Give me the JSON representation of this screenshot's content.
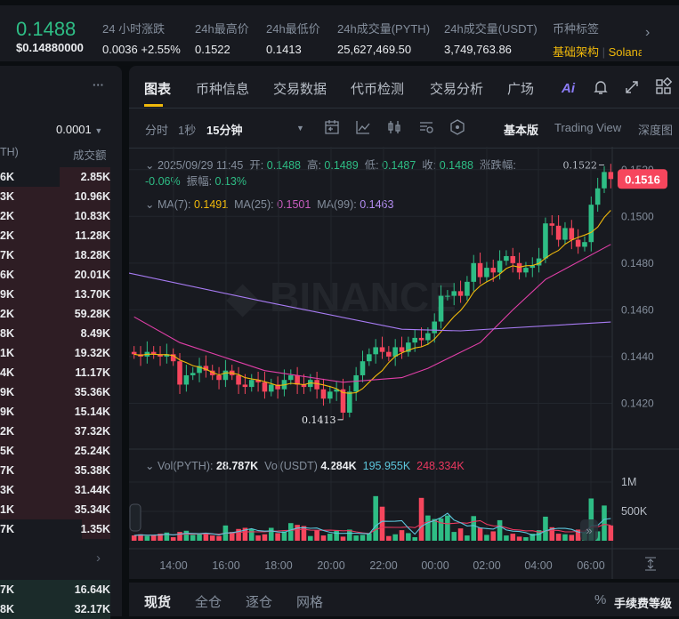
{
  "header": {
    "price": "0.1488",
    "price_usd": "$0.14880000",
    "stats": [
      {
        "label": "24 小时涨跌",
        "value": "0.0036 +2.55%"
      },
      {
        "label": "24h最高价",
        "value": "0.1522"
      },
      {
        "label": "24h最低价",
        "value": "0.1413"
      },
      {
        "label": "24h成交量(PYTH)",
        "value": "25,627,469.50"
      },
      {
        "label": "24h成交量(USDT)",
        "value": "3,749,763.86"
      }
    ],
    "tags_label": "币种标签",
    "tag1": "基础架构",
    "tag2": "Solana"
  },
  "orderbook": {
    "more": "···",
    "precision": "0.0001",
    "col_left": "TH)",
    "col_right": "成交额",
    "asks": [
      [
        "6K",
        "2.85K"
      ],
      [
        "3K",
        "10.96K"
      ],
      [
        "2K",
        "10.83K"
      ],
      [
        "2K",
        "11.28K"
      ],
      [
        "7K",
        "18.28K"
      ],
      [
        "6K",
        "20.01K"
      ],
      [
        "9K",
        "13.70K"
      ],
      [
        "2K",
        "59.28K"
      ],
      [
        "8K",
        "8.49K"
      ],
      [
        "1K",
        "19.32K"
      ],
      [
        "4K",
        "11.17K"
      ],
      [
        "9K",
        "35.36K"
      ],
      [
        "9K",
        "15.14K"
      ],
      [
        "2K",
        "37.32K"
      ],
      [
        "5K",
        "25.24K"
      ],
      [
        "7K",
        "35.38K"
      ],
      [
        "3K",
        "31.44K"
      ],
      [
        "1K",
        "35.34K"
      ],
      [
        "7K",
        "1.35K"
      ]
    ],
    "bids": [
      [
        "7K",
        "16.64K"
      ],
      [
        "8K",
        "32.17K"
      ]
    ]
  },
  "tabs": [
    "图表",
    "币种信息",
    "交易数据",
    "代币检测",
    "交易分析",
    "广场"
  ],
  "ai_label": "Ai",
  "toolbar": {
    "intervals": [
      "分时",
      "1秒",
      "15分钟"
    ],
    "views": [
      "基本版",
      "Trading View",
      "深度图"
    ]
  },
  "legend": {
    "date": "2025/09/29 11:45",
    "open_l": "开:",
    "open": "0.1488",
    "high_l": "高:",
    "high": "0.1489",
    "low_l": "低:",
    "low": "0.1487",
    "close_l": "收:",
    "close": "0.1488",
    "chg_l": "涨跌幅:",
    "chg": "-0.06%",
    "amp_l": "振幅:",
    "amp": "0.13%",
    "ma7_l": "MA(7):",
    "ma7": "0.1491",
    "ma25_l": "MA(25):",
    "ma25": "0.1501",
    "ma99_l": "MA(99):",
    "ma99": "0.1463",
    "vol_l": "Vol(PYTH):",
    "vol": "28.787K",
    "volu_l": "Vol(USDT)",
    "volu": "4.284K",
    "vma5": "195.955K",
    "vma10": "248.334K"
  },
  "colors": {
    "up": "#2ebd85",
    "down": "#f6465d",
    "ma7": "#f0b90b",
    "ma25": "#e13fa8",
    "ma99": "#a77bf3",
    "vma5": "#5cc6dc",
    "vma10": "#e8385f"
  },
  "chart_data": {
    "type": "candlestick",
    "y_ticks": [
      "0.1520",
      "0.1500",
      "0.1480",
      "0.1460",
      "0.1440",
      "0.1420"
    ],
    "y_range": [
      0.1408,
      0.1526
    ],
    "x_ticks": [
      "14:00",
      "16:00",
      "18:00",
      "20:00",
      "22:00",
      "00:00",
      "02:00",
      "04:00",
      "06:00"
    ],
    "current_price": "0.1516",
    "max_label": "0.1522",
    "min_label": "0.1413",
    "closes": [
      0.1441,
      0.144,
      0.1442,
      0.1441,
      0.144,
      0.1441,
      0.1438,
      0.1428,
      0.1432,
      0.1433,
      0.1436,
      0.1434,
      0.1432,
      0.143,
      0.1434,
      0.1432,
      0.1428,
      0.1427,
      0.143,
      0.1429,
      0.1425,
      0.1428,
      0.1426,
      0.143,
      0.1432,
      0.1428,
      0.1427,
      0.143,
      0.1426,
      0.1422,
      0.1425,
      0.1426,
      0.1416,
      0.1425,
      0.1432,
      0.1438,
      0.1441,
      0.1444,
      0.1442,
      0.144,
      0.1444,
      0.1442,
      0.1446,
      0.1448,
      0.1447,
      0.145,
      0.1455,
      0.1466,
      0.1466,
      0.1468,
      0.1466,
      0.1472,
      0.148,
      0.1474,
      0.1478,
      0.1476,
      0.1481,
      0.1483,
      0.148,
      0.1476,
      0.1478,
      0.1479,
      0.1482,
      0.1497,
      0.1496,
      0.149,
      0.1495,
      0.149,
      0.1487,
      0.1489,
      0.1505,
      0.1512,
      0.1519,
      0.1516
    ],
    "ma25": [
      [
        0,
        0.1457
      ],
      [
        7,
        0.1446
      ],
      [
        20,
        0.1434
      ],
      [
        32,
        0.1429
      ],
      [
        41,
        0.1431
      ],
      [
        45,
        0.1435
      ],
      [
        53,
        0.1446
      ],
      [
        58,
        0.146
      ],
      [
        63,
        0.1473
      ],
      [
        73,
        0.1488
      ]
    ],
    "ma99": [
      [
        0,
        0.14757
      ],
      [
        20,
        0.14635
      ],
      [
        41,
        0.14517
      ],
      [
        50,
        0.1451
      ],
      [
        73,
        0.14548
      ]
    ],
    "vol_ticks": [
      "1M",
      "500K"
    ],
    "volumes": [
      90,
      110,
      80,
      100,
      120,
      140,
      60,
      150,
      170,
      100,
      120,
      110,
      90,
      80,
      260,
      150,
      200,
      220,
      200,
      90,
      110,
      220,
      130,
      160,
      300,
      270,
      250,
      80,
      180,
      90,
      120,
      170,
      70,
      190,
      90,
      100,
      130,
      760,
      580,
      80,
      110,
      180,
      130,
      60,
      730,
      430,
      370,
      380,
      430,
      150,
      210,
      90,
      420,
      220,
      100,
      160,
      350,
      90,
      120,
      70,
      60,
      120,
      180,
      410,
      230,
      120,
      110,
      100,
      190,
      150,
      720,
      160,
      600,
      260
    ]
  },
  "bottom": {
    "tabs": [
      "现货",
      "全仓",
      "逐仓",
      "网格"
    ],
    "fee_icon": "%",
    "fee": "手续费等级"
  }
}
